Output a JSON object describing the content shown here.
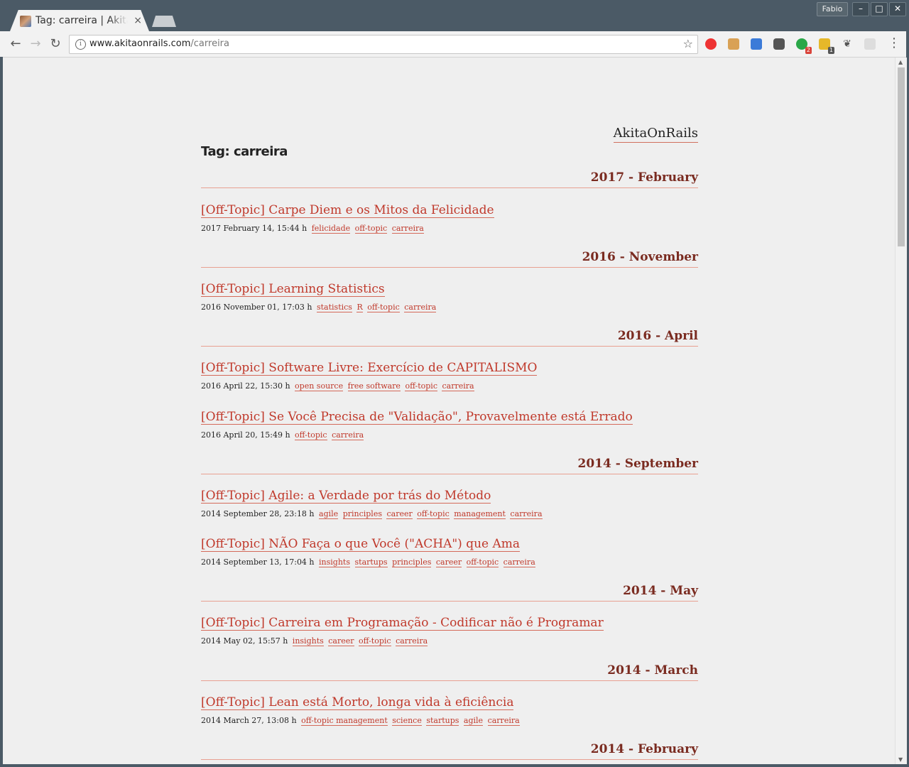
{
  "browser": {
    "tab_title": "Tag: carreira | AkitaOnRails",
    "tab_close": "×",
    "profile_name": "Fabio",
    "url_host": "www.akitaonrails.com",
    "url_path": "/carreira",
    "extension_badges": [
      "2",
      "1"
    ],
    "accent": "#4b5a66"
  },
  "page": {
    "site_title": "AkitaOnRails",
    "tag_heading": "Tag: carreira",
    "link_color": "#c0392b",
    "month_color": "#7a2b20",
    "sections": [
      {
        "month": "2017 - February",
        "posts": [
          {
            "title": "[Off-Topic] Carpe Diem e os Mitos da Felicidade",
            "date": "2017 February 14, 15:44 h",
            "tags": [
              "felicidade",
              "off-topic",
              "carreira"
            ]
          }
        ]
      },
      {
        "month": "2016 - November",
        "posts": [
          {
            "title": "[Off-Topic] Learning Statistics",
            "date": "2016 November 01, 17:03 h",
            "tags": [
              "statistics",
              "R",
              "off-topic",
              "carreira"
            ]
          }
        ]
      },
      {
        "month": "2016 - April",
        "posts": [
          {
            "title": "[Off-Topic] Software Livre: Exercício de CAPITALISMO",
            "date": "2016 April 22, 15:30 h",
            "tags": [
              "open source",
              "free software",
              "off-topic",
              "carreira"
            ]
          },
          {
            "title": "[Off-Topic] Se Você Precisa de \"Validação\", Provavelmente está Errado",
            "date": "2016 April 20, 15:49 h",
            "tags": [
              "off-topic",
              "carreira"
            ]
          }
        ]
      },
      {
        "month": "2014 - September",
        "posts": [
          {
            "title": "[Off-Topic] Agile: a Verdade por trás do Método",
            "date": "2014 September 28, 23:18 h",
            "tags": [
              "agile",
              "principles",
              "career",
              "off-topic",
              "management",
              "carreira"
            ]
          },
          {
            "title": "[Off-Topic] NÃO Faça o que Você (\"ACHA\") que Ama",
            "date": "2014 September 13, 17:04 h",
            "tags": [
              "insights",
              "startups",
              "principles",
              "career",
              "off-topic",
              "carreira"
            ]
          }
        ]
      },
      {
        "month": "2014 - May",
        "posts": [
          {
            "title": "[Off-Topic] Carreira em Programação - Codificar não é Programar",
            "date": "2014 May 02, 15:57 h",
            "tags": [
              "insights",
              "career",
              "off-topic",
              "carreira"
            ]
          }
        ]
      },
      {
        "month": "2014 - March",
        "posts": [
          {
            "title": "[Off-Topic] Lean está Morto, longa vida à eficiência",
            "date": "2014 March 27, 13:08 h",
            "tags": [
              "off-topic management",
              "science",
              "startups",
              "agile",
              "carreira"
            ]
          }
        ]
      },
      {
        "month": "2014 - February",
        "posts": []
      }
    ]
  }
}
